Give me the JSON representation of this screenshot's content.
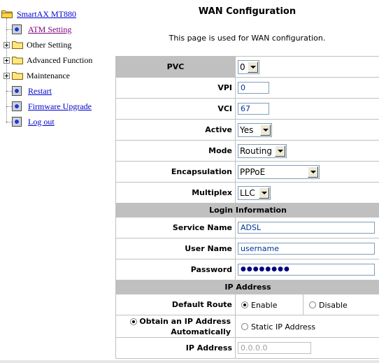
{
  "nav": {
    "root": "SmartAX MT880",
    "items": [
      {
        "label": "ATM Setting",
        "type": "page",
        "link": true
      },
      {
        "label": "Other Setting",
        "type": "folder",
        "link": false
      },
      {
        "label": "Advanced Function",
        "type": "folder",
        "link": false
      },
      {
        "label": "Maintenance",
        "type": "folder",
        "link": false
      },
      {
        "label": "Restart",
        "type": "page",
        "link": true
      },
      {
        "label": "Firmware Upgrade",
        "type": "page",
        "link": true
      },
      {
        "label": "Log out",
        "type": "page",
        "link": true
      }
    ]
  },
  "page": {
    "title": "WAN Configuration",
    "description": "This page is used for WAN configuration."
  },
  "form": {
    "pvc": {
      "label": "PVC",
      "value": "0"
    },
    "vpi": {
      "label": "VPI",
      "value": "0"
    },
    "vci": {
      "label": "VCI",
      "value": "67"
    },
    "active": {
      "label": "Active",
      "value": "Yes"
    },
    "mode": {
      "label": "Mode",
      "value": "Routing"
    },
    "encapsulation": {
      "label": "Encapsulation",
      "value": "PPPoE"
    },
    "multiplex": {
      "label": "Multiplex",
      "value": "LLC"
    },
    "login_section": "Login Information",
    "service_name": {
      "label": "Service Name",
      "value": "ADSL"
    },
    "user_name": {
      "label": "User Name",
      "value": "username"
    },
    "password": {
      "label": "Password",
      "value": "●●●●●●●●"
    },
    "ip_section": "IP Address",
    "default_route": {
      "label": "Default Route",
      "option_enable": "Enable",
      "option_disable": "Disable",
      "selected": "Enable"
    },
    "obtain_ip": {
      "label_line1": "Obtain an IP Address",
      "label_line2": "Automatically",
      "static_label": "Static IP Address",
      "selected": "obtain"
    },
    "ip_address": {
      "label": "IP Address",
      "value": "0.0.0.0"
    }
  },
  "colors": {
    "link": "#0000cc",
    "visited_link": "#800080",
    "section_bg": "#c0c0c0",
    "input_text": "#003399"
  }
}
